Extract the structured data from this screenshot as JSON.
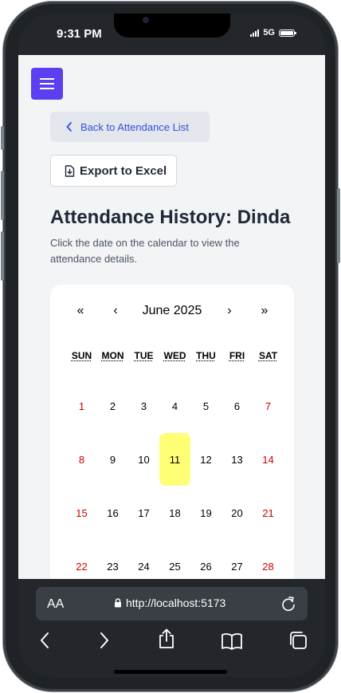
{
  "status": {
    "time": "9:31 PM",
    "network": "5G"
  },
  "nav": {
    "back_label": "Back to Attendance List",
    "export_label": "Export to Excel"
  },
  "page": {
    "title": "Attendance History: Dinda",
    "subtitle": "Click the date on the calendar to view the attendance details."
  },
  "calendar": {
    "prev_year": "«",
    "prev_month": "‹",
    "next_month": "›",
    "next_year": "»",
    "title": "June 2025",
    "weekdays": [
      "SUN",
      "MON",
      "TUE",
      "WED",
      "THU",
      "FRI",
      "SAT"
    ],
    "weeks": [
      [
        "1",
        "2",
        "3",
        "4",
        "5",
        "6",
        "7"
      ],
      [
        "8",
        "9",
        "10",
        "11",
        "12",
        "13",
        "14"
      ],
      [
        "15",
        "16",
        "17",
        "18",
        "19",
        "20",
        "21"
      ],
      [
        "22",
        "23",
        "24",
        "25",
        "26",
        "27",
        "28"
      ]
    ],
    "selected_day": "11",
    "weekend_color": "#d10000",
    "highlight_color": "#ffff76"
  },
  "browser": {
    "text_size_label": "AA",
    "url": "http://localhost:5173"
  },
  "colors": {
    "accent": "#5b3ff0",
    "link": "#3450d8"
  }
}
